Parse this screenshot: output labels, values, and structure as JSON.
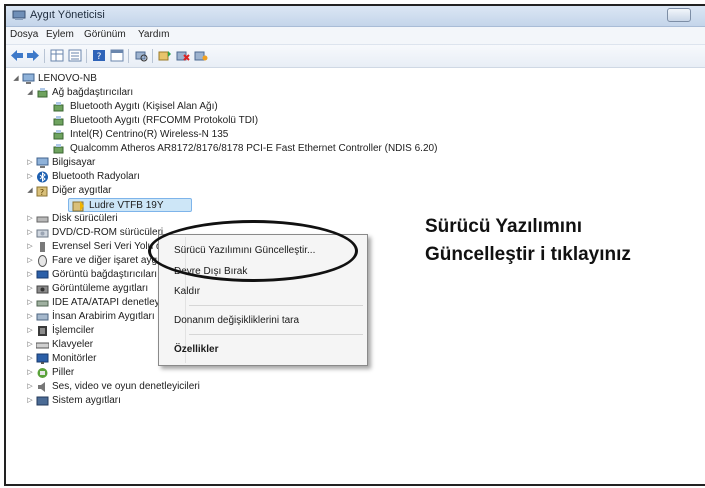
{
  "window": {
    "title": "Aygıt Yöneticisi"
  },
  "menu": [
    "Dosya",
    "Eylem",
    "Görünüm",
    "Yardım"
  ],
  "tree": {
    "root": "LENOVO-NB",
    "rows": [
      {
        "label": "Ağ bağdaştırıcıları"
      },
      {
        "label": "Bluetooth Aygıtı (Kişisel Alan Ağı)"
      },
      {
        "label": "Bluetooth Aygıtı (RFCOMM Protokolü TDI)"
      },
      {
        "label": "Intel(R) Centrino(R) Wireless-N 135"
      },
      {
        "label": "Qualcomm Atheros AR8172/8176/8178 PCI-E Fast Ethernet Controller (NDIS 6.20)"
      },
      {
        "label": "Bilgisayar"
      },
      {
        "label": "Bluetooth Radyoları"
      },
      {
        "label": "Diğer aygıtlar"
      },
      {
        "label": "Ludre VTFB 19Y"
      },
      {
        "label": "Disk sürücüleri"
      },
      {
        "label": "DVD/CD-ROM sürücüleri"
      },
      {
        "label": "Evrensel Seri Veri Yolu denetleyicileri"
      },
      {
        "label": "Fare ve diğer işaret aygıtları"
      },
      {
        "label": "Görüntü bağdaştırıcıları"
      },
      {
        "label": "Görüntüleme aygıtları"
      },
      {
        "label": "IDE ATA/ATAPI denetleyicileri"
      },
      {
        "label": "İnsan Arabirim Aygıtları"
      },
      {
        "label": "İşlemciler"
      },
      {
        "label": "Klavyeler"
      },
      {
        "label": "Monitörler"
      },
      {
        "label": "Piller"
      },
      {
        "label": "Ses, video ve oyun denetleyicileri"
      },
      {
        "label": "Sistem aygıtları"
      }
    ]
  },
  "context_menu": {
    "update": "Sürücü Yazılımını Güncelleştir...",
    "disable": "Devre Dışı Bırak",
    "uninstall": "Kaldır",
    "scan": "Donanım değişikliklerini tara",
    "properties": "Özellikler"
  },
  "callout": {
    "line1": "Sürücü Yazılımını",
    "line2": "Güncelleştir i tıklayınız"
  }
}
